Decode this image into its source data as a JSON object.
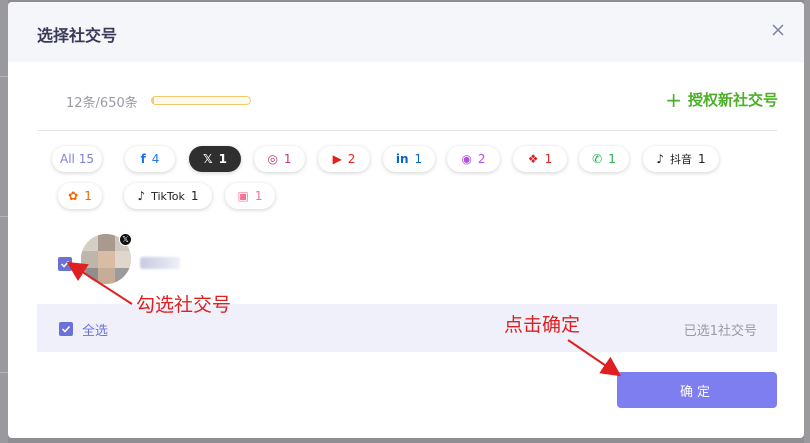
{
  "dialog": {
    "title": "选择社交号",
    "close_icon": "close-icon"
  },
  "quota": {
    "text": "12条/650条",
    "fraction": 0.018
  },
  "auth_link": {
    "plus": "+",
    "label": "授权新社交号"
  },
  "filters": [
    {
      "name": "all",
      "icon": "",
      "label": "All 15",
      "count": "",
      "color": "#7b82d8"
    },
    {
      "name": "facebook",
      "icon": "f",
      "label": "",
      "count": "4",
      "color": "#1877f2"
    },
    {
      "name": "x",
      "icon": "𝕏",
      "label": "",
      "count": "1",
      "color": "#ffffff",
      "active": true
    },
    {
      "name": "instagram",
      "icon": "◎",
      "label": "",
      "count": "1",
      "color": "#c13584"
    },
    {
      "name": "youtube",
      "icon": "▶",
      "label": "",
      "count": "2",
      "color": "#e62117"
    },
    {
      "name": "linkedin",
      "icon": "in",
      "label": "",
      "count": "1",
      "color": "#0a66c2"
    },
    {
      "name": "podcast",
      "icon": "◉",
      "label": "",
      "count": "2",
      "color": "#b150e2"
    },
    {
      "name": "xiaohongshu",
      "icon": "❖",
      "label": "",
      "count": "1",
      "color": "#d8232a"
    },
    {
      "name": "wechat",
      "icon": "✆",
      "label": "",
      "count": "1",
      "color": "#22b24c"
    },
    {
      "name": "douyin",
      "icon": "♪",
      "label": "抖音",
      "count": "1",
      "color": "#222222"
    },
    {
      "name": "kuaishou",
      "icon": "✿",
      "label": "",
      "count": "1",
      "color": "#f56500"
    },
    {
      "name": "tiktok",
      "icon": "♪",
      "label": "TikTok",
      "count": "1",
      "color": "#222222"
    },
    {
      "name": "bilibili",
      "icon": "▣",
      "label": "",
      "count": "1",
      "color": "#fb7299"
    }
  ],
  "account": {
    "checked": true,
    "badge": "𝕏",
    "name": "...."
  },
  "annotations": {
    "select_account": "勾选社交号",
    "click_confirm": "点击确定",
    "color": "#e02020"
  },
  "footer": {
    "select_all": "全选",
    "selected_count": "已选1社交号"
  },
  "confirm_button": "确定"
}
